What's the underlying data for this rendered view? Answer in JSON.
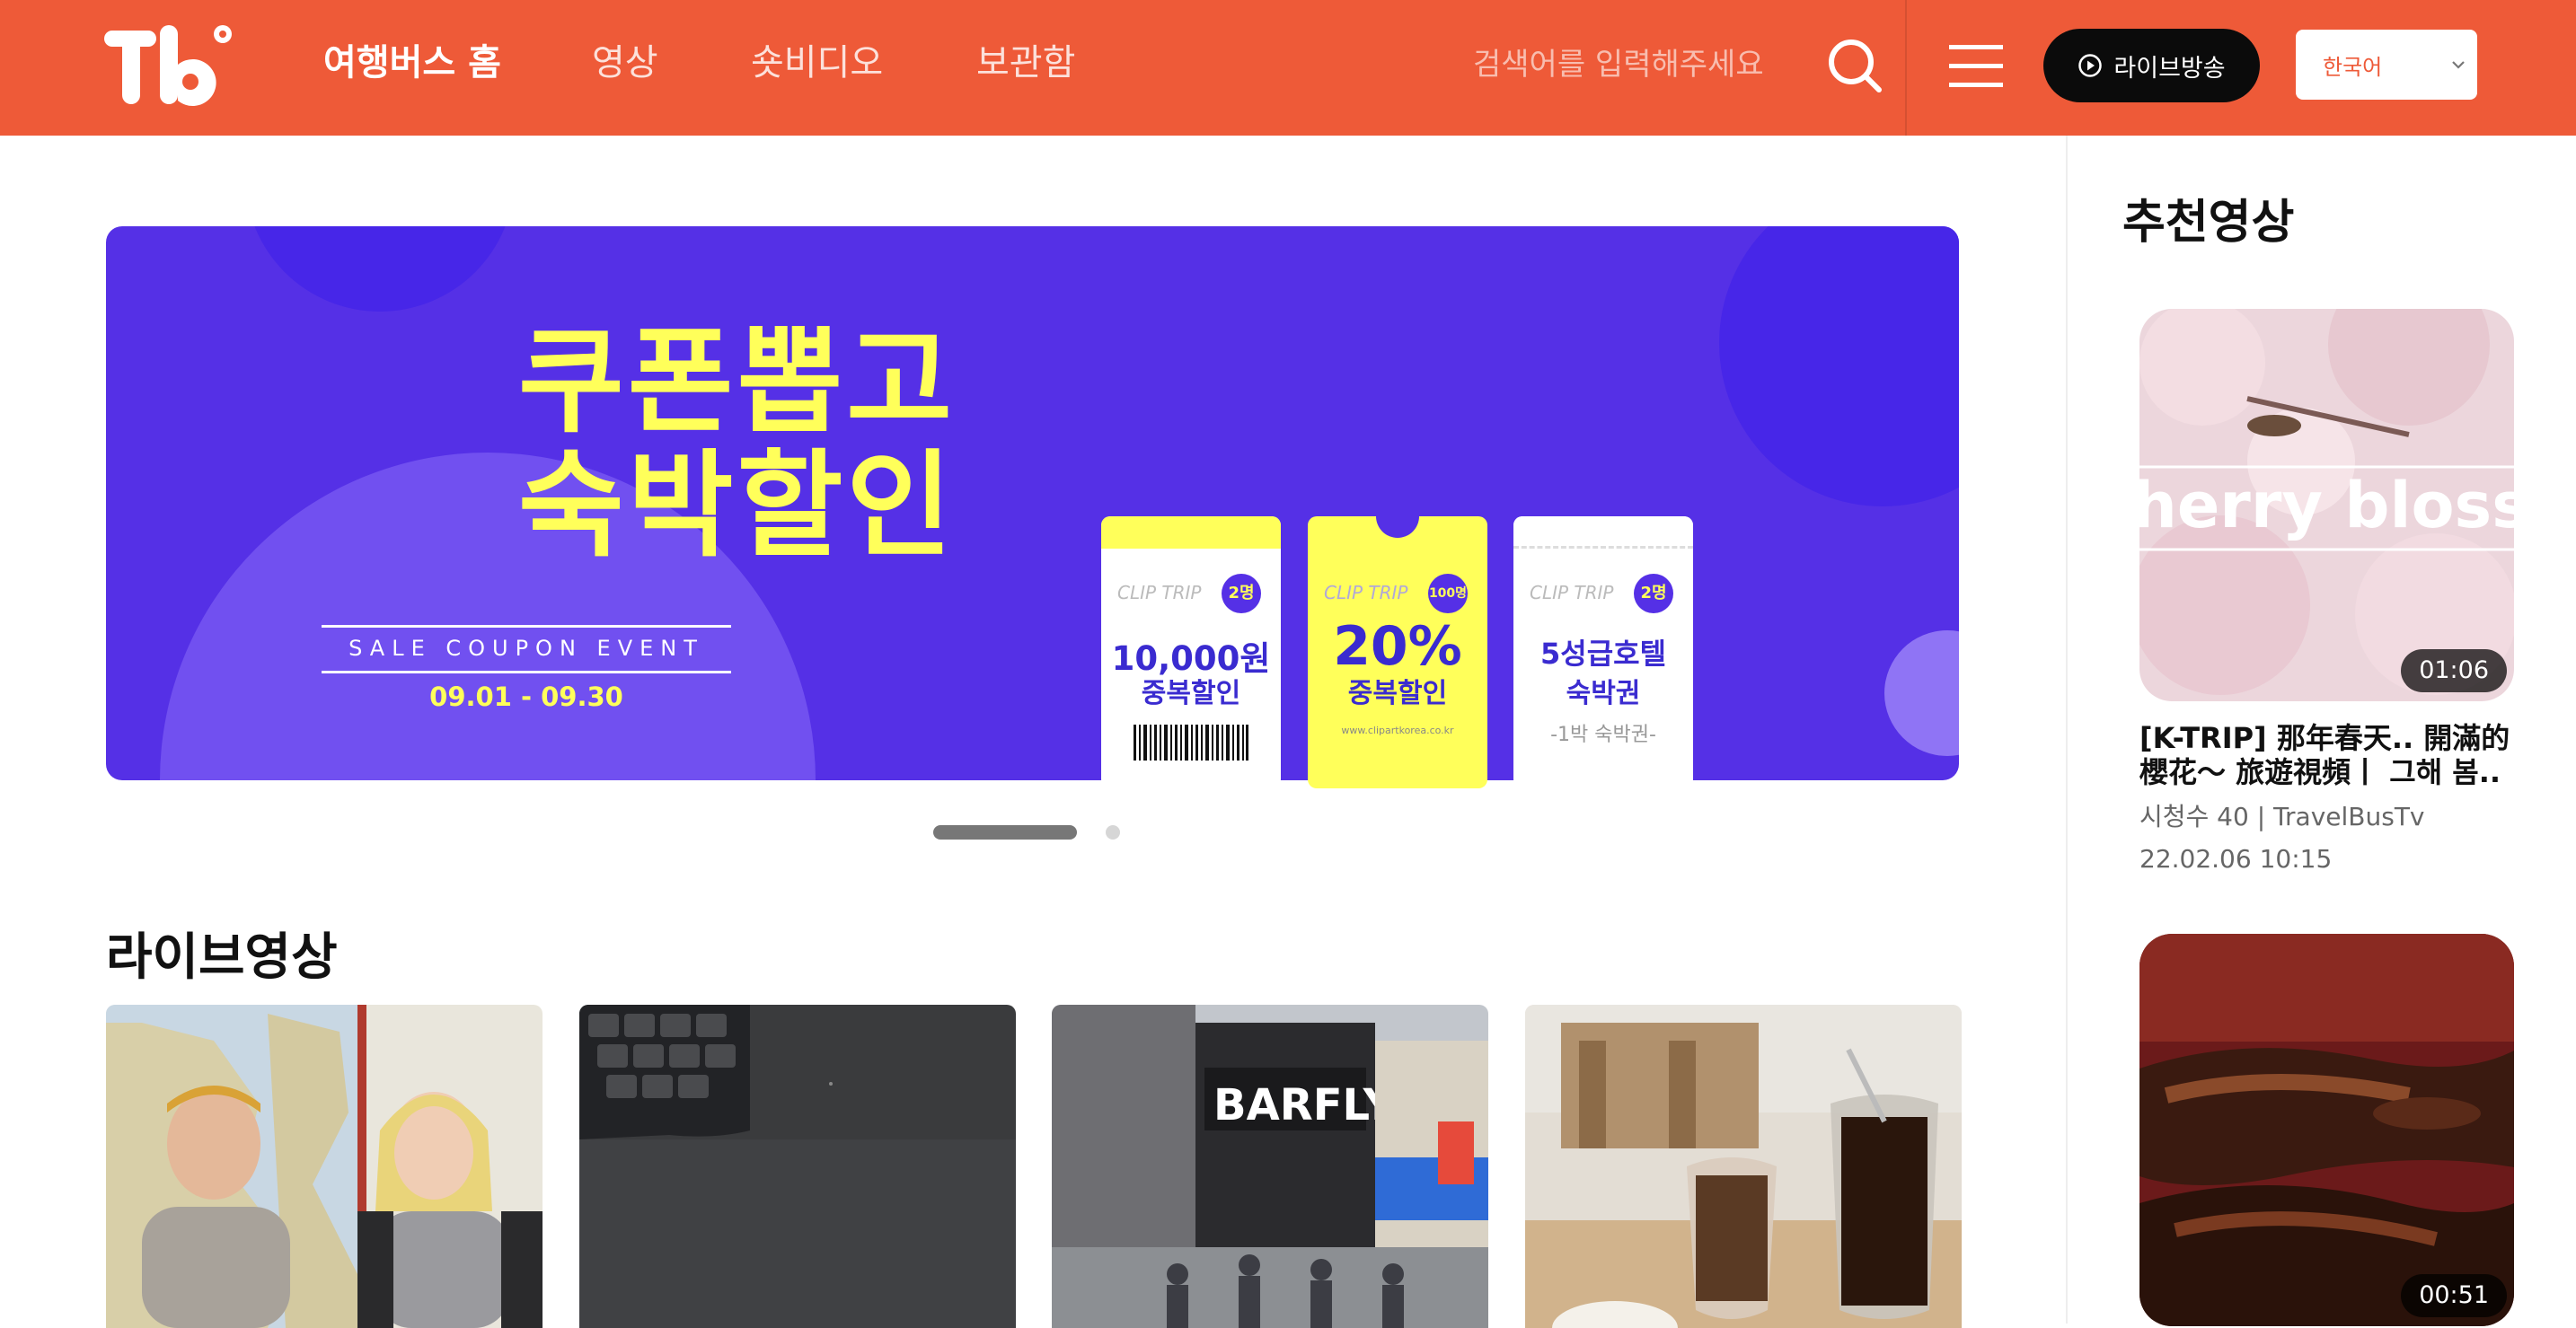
{
  "header": {
    "logo_text": "Tb",
    "nav": [
      {
        "label": "여행버스 홈"
      },
      {
        "label": "영상"
      },
      {
        "label": "숏비디오"
      },
      {
        "label": "보관함"
      }
    ],
    "search_placeholder": "검색어를 입력해주세요",
    "live_button": "라이브방송",
    "language": "한국어"
  },
  "banner": {
    "headline_1": "쿠폰뽑고",
    "headline_2": "숙박할인",
    "event_label": "SALE COUPON EVENT",
    "date_range": "09.01 - 09.30",
    "coupons": [
      {
        "brand": "CLIP TRIP",
        "badge": "2명",
        "value": "10,000원",
        "sub": "중복할인",
        "note": ""
      },
      {
        "brand": "CLIP TRIP",
        "badge": "100명",
        "value": "20%",
        "sub": "중복할인",
        "note": "www.clipartkorea.co.kr"
      },
      {
        "brand": "CLIP TRIP",
        "badge": "2명",
        "value": "5성급호텔",
        "sub": "숙박권",
        "note": "-1박 숙박권-"
      }
    ],
    "slides": {
      "current": 1,
      "total": 2
    }
  },
  "live_section": {
    "title": "라이브영상",
    "videos": [
      {
        "thumb": "two-hosts-studio"
      },
      {
        "thumb": "desk-keyboard"
      },
      {
        "thumb": "barfly-street"
      },
      {
        "thumb": "cafe-coffee"
      }
    ]
  },
  "recommended": {
    "title": "추천영상",
    "items": [
      {
        "duration": "01:06",
        "overlay_text": "herry blossom",
        "title": "[K-TRIP] 那年春天.. 開滿的櫻花〜 旅遊視頻丨 그해 봄..",
        "views": "시청수 40 | TravelBusTv",
        "date": "22.02.06 10:15"
      },
      {
        "duration": "00:51"
      }
    ]
  },
  "colors": {
    "brand": "#ee5a38",
    "banner_bg": "#5530e6",
    "banner_accent": "#ffff5a",
    "live_button": "#0b0b0b"
  }
}
